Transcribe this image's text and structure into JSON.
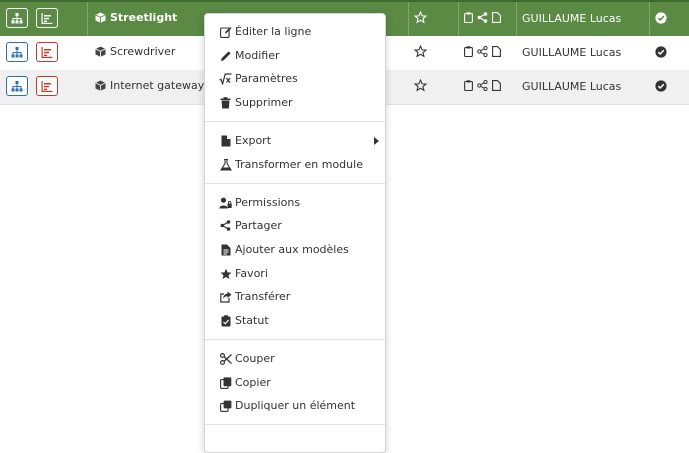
{
  "rows": [
    {
      "name": "Streetlight",
      "user": "GUILLAUME Lucas",
      "selected": true
    },
    {
      "name": "Screwdriver",
      "user": "GUILLAUME Lucas",
      "selected": false
    },
    {
      "name": "Internet gateway",
      "user": "GUILLAUME Lucas",
      "selected": false
    }
  ],
  "colors": {
    "selected_row": "#5a8a44",
    "hierarchy_blue": "#2c6fb4",
    "chart_red": "#c0392b"
  },
  "context_menu": {
    "edit_row": "Éditer la ligne",
    "modify": "Modifier",
    "parameters": "Paramètres",
    "delete": "Supprimer",
    "export": "Export",
    "transform_module": "Transformer en module",
    "permissions": "Permissions",
    "share": "Partager",
    "add_templates": "Ajouter aux modèles",
    "favorite": "Favori",
    "transfer": "Transférer",
    "status": "Statut",
    "cut": "Couper",
    "copy": "Copier",
    "duplicate": "Dupliquer un élément"
  }
}
